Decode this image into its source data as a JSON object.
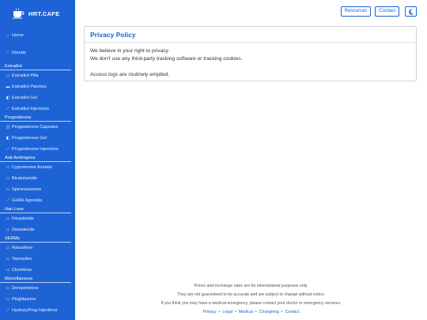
{
  "brand": {
    "name": "HRT.CAFE",
    "logo_icon": "coffee-cup-icon"
  },
  "topbar": {
    "resources_label": "Resources",
    "contact_label": "Contact",
    "theme_icon": "moon-icon"
  },
  "sidebar": {
    "top_items": [
      {
        "label": "Home",
        "icon": "home-icon"
      },
      {
        "label": "Donate",
        "icon": "donate-icon"
      }
    ],
    "sections": [
      {
        "title": "Estradiol",
        "items": [
          {
            "label": "Estradiol Pills",
            "icon": "pill-icon"
          },
          {
            "label": "Estradiol Patches",
            "icon": "patch-icon"
          },
          {
            "label": "Estradiol Gel",
            "icon": "gel-icon"
          },
          {
            "label": "Estradiol Injections",
            "icon": "syringe-icon"
          }
        ]
      },
      {
        "title": "Progesterone",
        "items": [
          {
            "label": "Progesterone Capsules",
            "icon": "capsule-icon"
          },
          {
            "label": "Progesterone Gel",
            "icon": "gel-icon"
          },
          {
            "label": "Progesterone Injections",
            "icon": "syringe-icon"
          }
        ]
      },
      {
        "title": "Anti-Androgens",
        "items": [
          {
            "label": "Cyproterone Acetate",
            "icon": "pill-icon"
          },
          {
            "label": "Bicalutamide",
            "icon": "pill-icon"
          },
          {
            "label": "Spironolactone",
            "icon": "pill-icon"
          },
          {
            "label": "GnRH Agonists",
            "icon": "syringe-icon"
          }
        ]
      },
      {
        "title": "Hair Loss",
        "items": [
          {
            "label": "Finasteride",
            "icon": "pill-icon"
          },
          {
            "label": "Dutasteride",
            "icon": "pill-icon"
          }
        ]
      },
      {
        "title": "SERMs",
        "items": [
          {
            "label": "Raloxifene",
            "icon": "pill-icon"
          },
          {
            "label": "Tamoxifen",
            "icon": "pill-icon"
          },
          {
            "label": "Clomifene",
            "icon": "pill-icon"
          }
        ]
      },
      {
        "title": "Miscellaneous",
        "items": [
          {
            "label": "Domperidone",
            "icon": "pill-icon"
          },
          {
            "label": "Pioglitazone",
            "icon": "pill-icon"
          },
          {
            "label": "HydroxyProg Injections",
            "icon": "syringe-icon"
          }
        ]
      }
    ]
  },
  "card": {
    "title": "Privacy Policy",
    "line1": "We believe in your right to privacy.",
    "line2": "We don't use any third-party tracking software or tracking cookies.",
    "line3": "Access logs are routinely emptied."
  },
  "footer": {
    "line1": "Prices and exchange rates are for informational purposes only.",
    "line2": "They are not guaranteed to be accurate and are subject to change without notice.",
    "line3": "If you think you may have a medical emergency, please contact your doctor or emergency services.",
    "links": [
      "Privacy",
      "Legal",
      "Medical",
      "Changelog",
      "Contact"
    ],
    "separator": "•"
  },
  "colors": {
    "accent": "#1d63d6",
    "sidebar_bg": "#1d63d6",
    "text": "#212529"
  }
}
